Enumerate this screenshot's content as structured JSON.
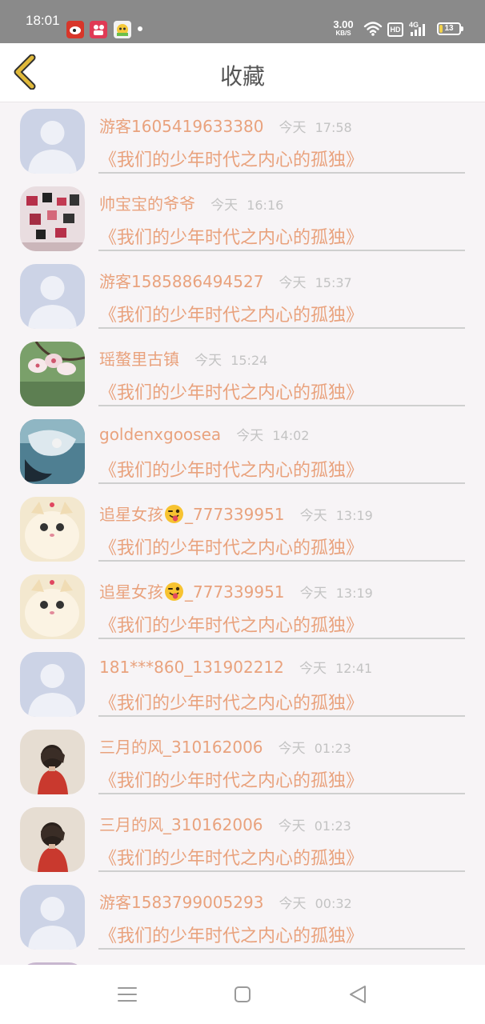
{
  "status_bar": {
    "time": "18:01",
    "net_speed_value": "3.00",
    "net_speed_unit": "KB/S",
    "hd_label": "HD",
    "signal_label": "4G",
    "battery_level": "13"
  },
  "header": {
    "title": "收藏",
    "back_icon": "chevron-left-icon",
    "accent_color": "#e0b93a"
  },
  "list": {
    "items": [
      {
        "user": "游客1605419633380",
        "day": "今天",
        "time": "17:58",
        "title": "《我们的少年时代之内心的孤独》",
        "avatar": "default-avatar"
      },
      {
        "user": "帅宝宝的爷爷",
        "day": "今天",
        "time": "16:16",
        "title": "《我们的少年时代之内心的孤独》",
        "avatar": "photo-wall-avatar"
      },
      {
        "user": "游客1585886494527",
        "day": "今天",
        "time": "15:37",
        "title": "《我们的少年时代之内心的孤独》",
        "avatar": "default-avatar"
      },
      {
        "user": "瑶螯里古镇",
        "day": "今天",
        "time": "15:24",
        "title": "《我们的少年时代之内心的孤独》",
        "avatar": "blossom-avatar"
      },
      {
        "user": "goldenxgoosea",
        "day": "今天",
        "time": "14:02",
        "title": "《我们的少年时代之内心的孤独》",
        "avatar": "underwater-avatar"
      },
      {
        "user_prefix": "追星女孩",
        "emoji": "tongue-wink-emoji",
        "user_suffix": "_777339951",
        "day": "今天",
        "time": "13:19",
        "title": "《我们的少年时代之内心的孤独》",
        "avatar": "cat-avatar"
      },
      {
        "user_prefix": "追星女孩",
        "emoji": "tongue-wink-emoji",
        "user_suffix": "_777339951",
        "day": "今天",
        "time": "13:19",
        "title": "《我们的少年时代之内心的孤独》",
        "avatar": "cat-avatar"
      },
      {
        "user": "181***860_131902212",
        "day": "今天",
        "time": "12:41",
        "title": "《我们的少年时代之内心的孤独》",
        "avatar": "default-avatar"
      },
      {
        "user": "三月的风_310162006",
        "day": "今天",
        "time": "01:23",
        "title": "《我们的少年时代之内心的孤独》",
        "avatar": "girl-avatar"
      },
      {
        "user": "三月的风_310162006",
        "day": "今天",
        "time": "01:23",
        "title": "《我们的少年时代之内心的孤独》",
        "avatar": "girl-avatar"
      },
      {
        "user": "游客1583799005293",
        "day": "今天",
        "time": "00:32",
        "title": "《我们的少年时代之内心的孤独》",
        "avatar": "default-avatar"
      }
    ]
  },
  "colors": {
    "name_color": "#e9a27d",
    "time_color": "#c3c3c3",
    "divider_color": "#cfcfcf"
  },
  "nav_bar": {
    "menu_icon": "menu-icon",
    "home_icon": "home-square-icon",
    "back_icon": "back-triangle-icon"
  }
}
